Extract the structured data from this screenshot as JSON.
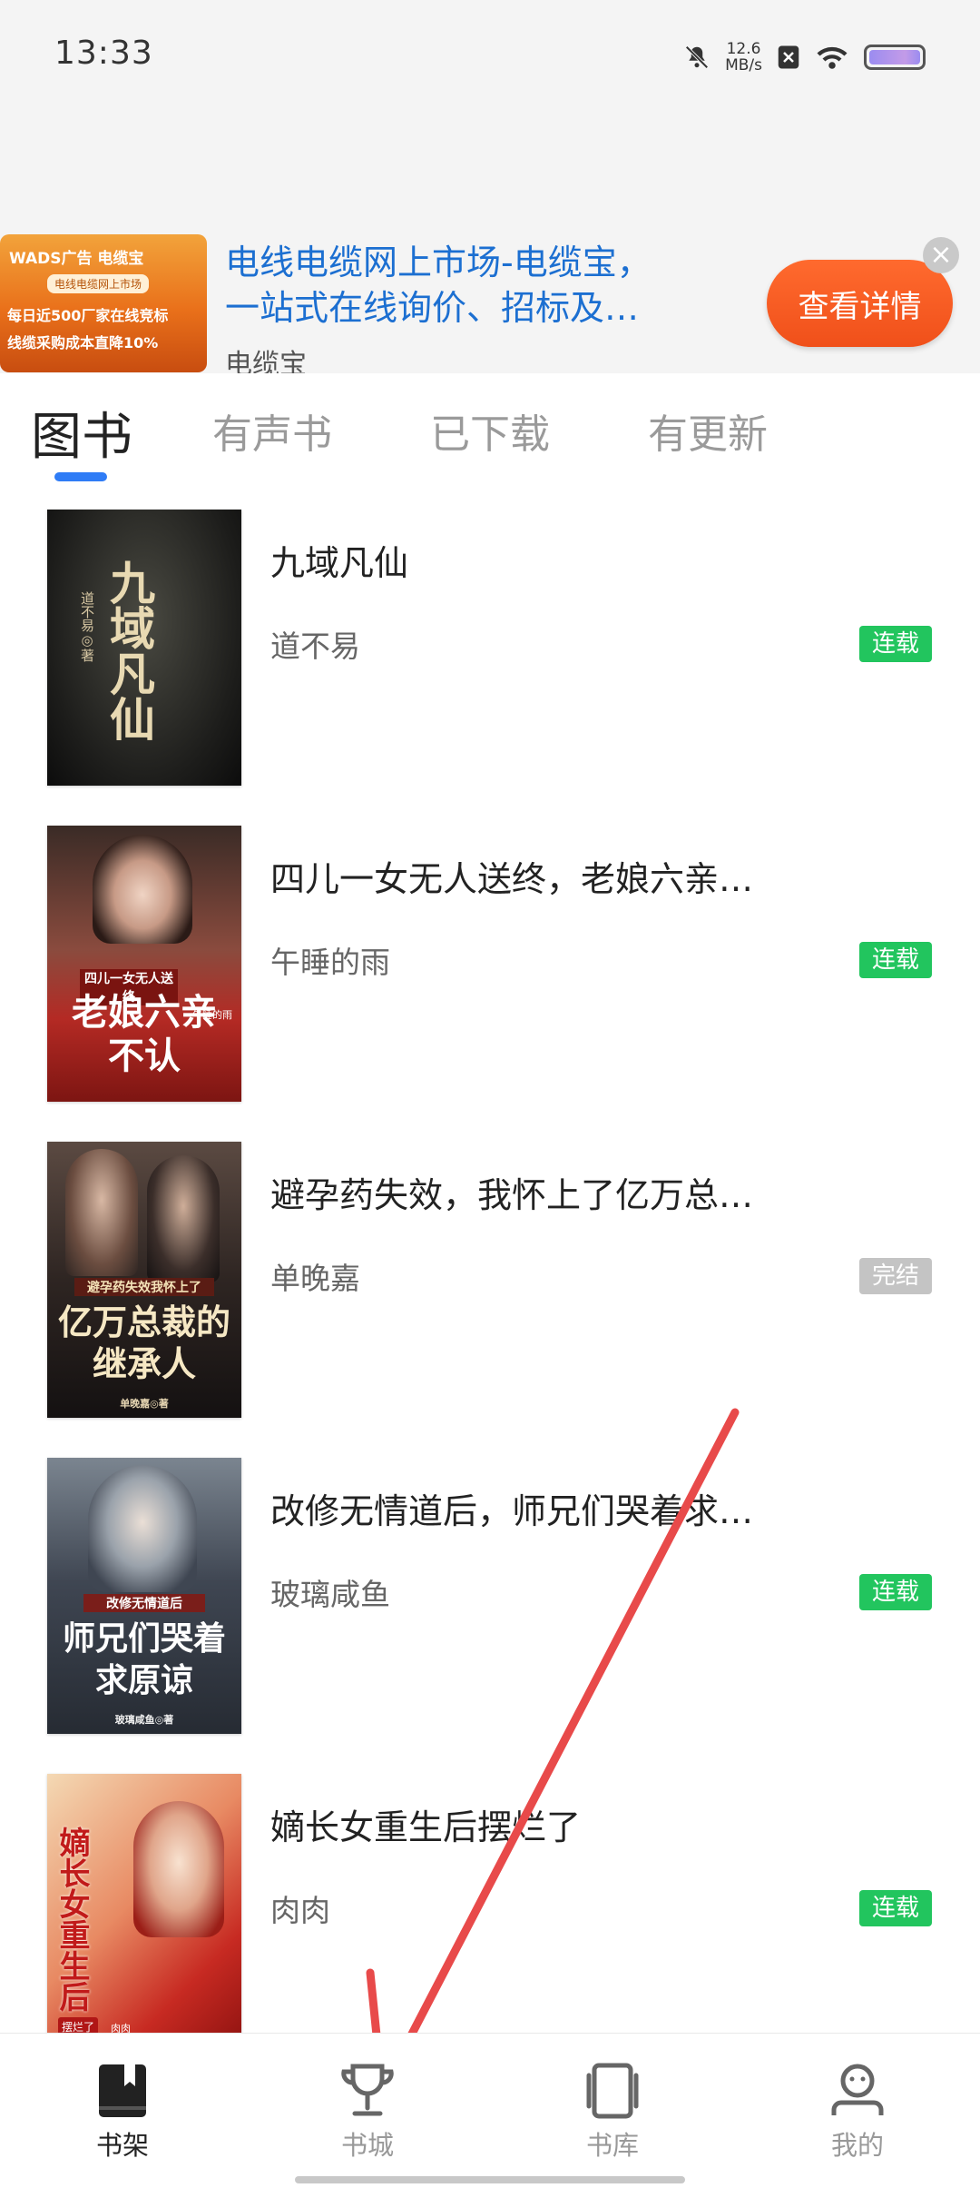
{
  "status_bar": {
    "time": "13:33",
    "net_speed_value": "12.6",
    "net_speed_unit": "MB/s",
    "icons": [
      "mute-bell-icon",
      "close-box-icon",
      "wifi-icon",
      "battery-icon"
    ]
  },
  "ad": {
    "thumb_brand": "WADS广告 电缆宝",
    "thumb_tag": "电线电缆网上市场",
    "thumb_line1": "每日近500厂家在线竞标",
    "thumb_line2": "线缆采购成本直降10%",
    "title_line1": "电线电缆网上市场-电缆宝，",
    "title_line2": "一站式在线询价、招标及…",
    "source": "电缆宝",
    "cta_label": "查看详情",
    "close_label": "×",
    "cta_color": "#f0501a"
  },
  "tabs": [
    {
      "label": "图书",
      "active": true
    },
    {
      "label": "有声书",
      "active": false
    },
    {
      "label": "已下载",
      "active": false
    },
    {
      "label": "有更新",
      "active": false
    }
  ],
  "books": [
    {
      "title": "九域凡仙",
      "author": "道不易",
      "status": "连载",
      "cover_text": "九域凡仙",
      "cover_author": "道不易◎著"
    },
    {
      "title": "四儿一女无人送终，老娘六亲…",
      "author": "午睡的雨",
      "status": "连载",
      "cover_text": "老娘六亲不认",
      "cover_subtitle": "四儿一女无人送终",
      "cover_author": "午睡的雨"
    },
    {
      "title": "避孕药失效，我怀上了亿万总…",
      "author": "单晚嘉",
      "status": "完结",
      "cover_text": "亿万总裁的继承人",
      "cover_subtitle": "避孕药失效我怀上了",
      "cover_author": "单晚嘉◎著"
    },
    {
      "title": "改修无情道后，师兄们哭着求…",
      "author": "玻璃咸鱼",
      "status": "连载",
      "cover_text": "师兄们哭着求原谅",
      "cover_subtitle": "改修无情道后",
      "cover_author": "玻璃咸鱼◎著"
    },
    {
      "title": "嫡长女重生后摆烂了",
      "author": "肉肉",
      "status": "连载",
      "cover_text": "嫡长女重生后",
      "cover_subtitle": "摆烂了",
      "cover_author": "肉肉"
    }
  ],
  "badge_colors": {
    "连载": "#22c55e",
    "完结": "#c4c4c4"
  },
  "bottom_nav": [
    {
      "label": "书架",
      "icon": "bookshelf-icon",
      "active": true
    },
    {
      "label": "书城",
      "icon": "trophy-icon",
      "active": false
    },
    {
      "label": "书库",
      "icon": "tablet-icon",
      "active": false
    },
    {
      "label": "我的",
      "icon": "profile-icon",
      "active": false
    }
  ],
  "accent_color": "#2f7cf6"
}
